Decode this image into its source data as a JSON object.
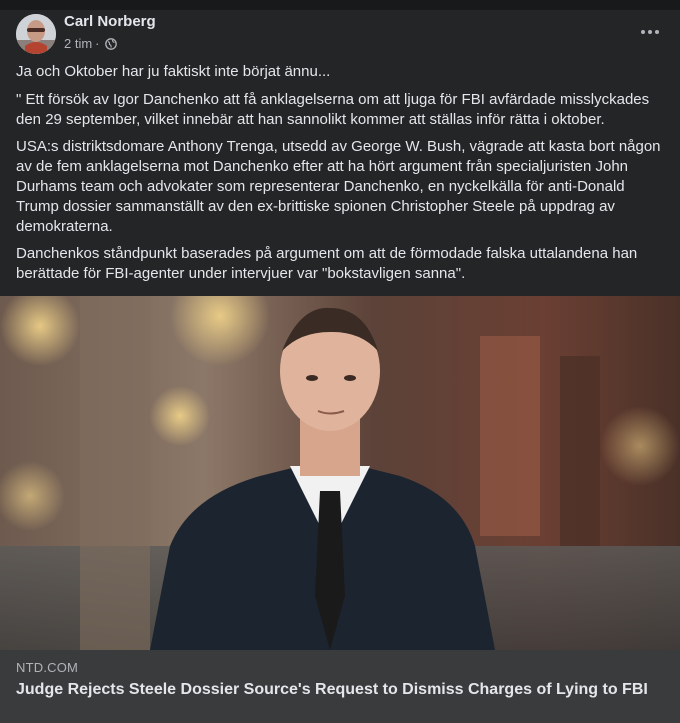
{
  "post": {
    "author": "Carl Norberg",
    "time": "2 tim",
    "separator": "·",
    "privacy_icon": "globe-icon",
    "more_icon": "more-horizontal-icon",
    "paragraphs": [
      "Ja och Oktober har ju faktiskt inte börjat ännu...",
      "\" Ett försök av Igor Danchenko att få anklagelserna om att ljuga för FBI avfärdade misslyckades den 29 september, vilket innebär att han sannolikt kommer att ställas inför rätta i oktober.",
      "USA:s distriktsdomare Anthony Trenga, utsedd av George W. Bush, vägrade att kasta bort någon av de fem anklagelserna mot Danchenko efter att ha hört argument från specialjuristen John Durhams team och advokater som representerar Danchenko, en nyckelkälla för anti-Donald Trump dossier sammanställt av den ex-brittiske spionen Christopher Steele på uppdrag av demokraterna.",
      "Danchenkos ståndpunkt baserades på argument om att de förmodade falska uttalandena han berättade för FBI-agenter under intervjuer var \"bokstavligen sanna\"."
    ]
  },
  "link": {
    "domain": "NTD.COM",
    "headline": "Judge Rejects Steele Dossier Source's Request to Dismiss Charges of Lying to FBI"
  },
  "colors": {
    "card_bg": "#242526",
    "footer_bg": "#3a3b3c",
    "text_primary": "#e4e6eb",
    "text_secondary": "#b0b3b8"
  }
}
